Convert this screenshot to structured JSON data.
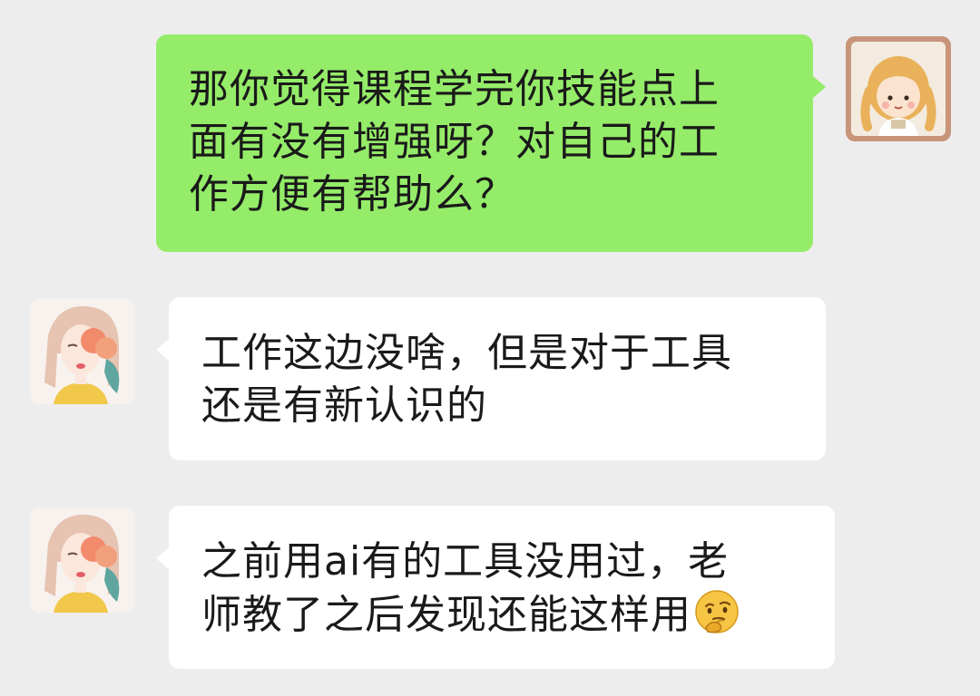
{
  "conversation": {
    "messages": [
      {
        "sender": "me",
        "lines": [
          "那你觉得课程学完你技能点上",
          "面有没有增强呀？对自己的工",
          "作方便有帮助么？"
        ]
      },
      {
        "sender": "contact",
        "lines": [
          "工作这边没啥，但是对于工具",
          "还是有新认识的"
        ]
      },
      {
        "sender": "contact",
        "lines": [
          "之前用ai有的工具没用过，老",
          "师教了之后发现还能这样用"
        ],
        "trailing_icon": "thinking-face-emoji"
      }
    ]
  },
  "colors": {
    "background": "#ededed",
    "sent_bubble": "#95ec69",
    "received_bubble": "#ffffff",
    "text": "#1a1a1a"
  }
}
